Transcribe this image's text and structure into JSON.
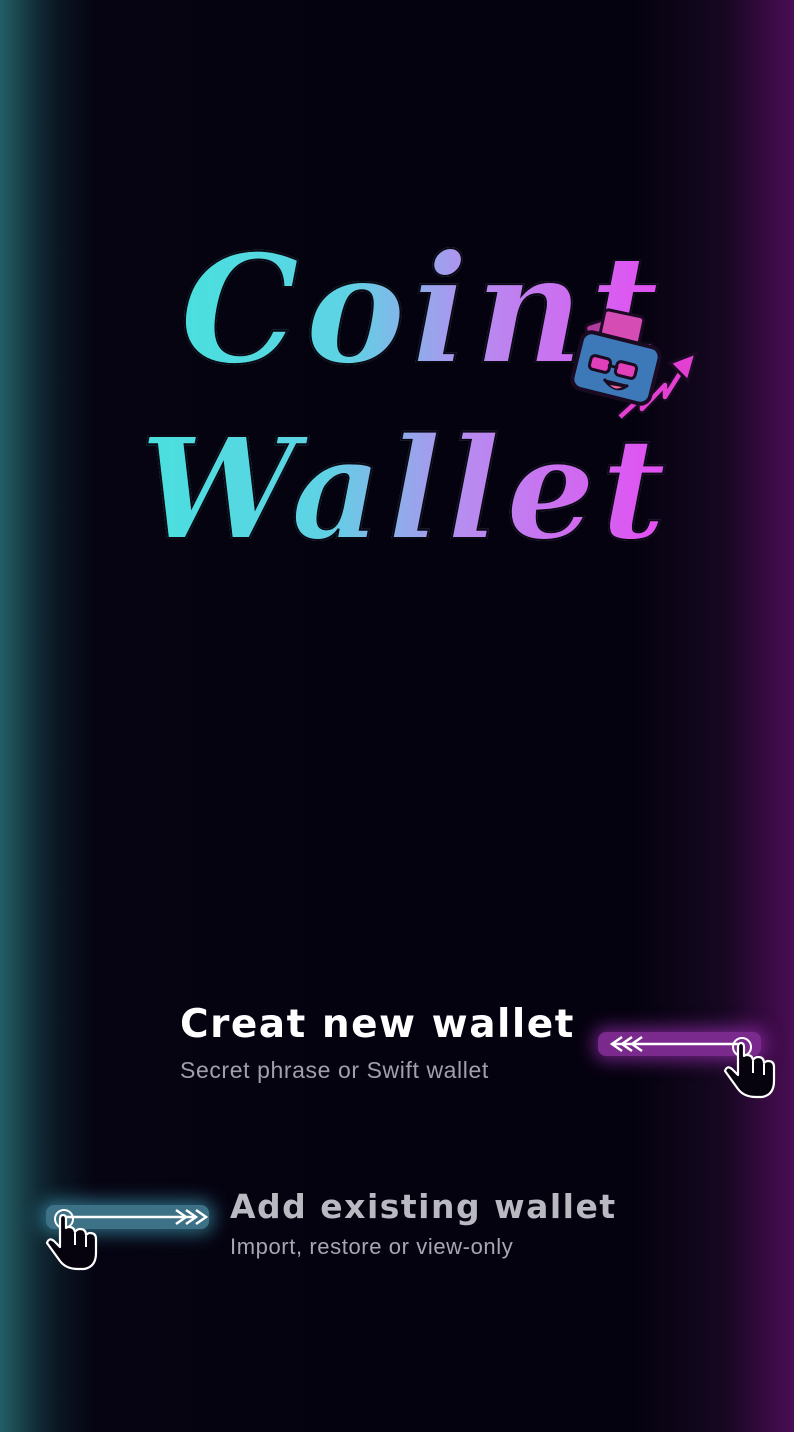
{
  "brand": {
    "line1": "Coint",
    "line2": "Wallet",
    "mascot_icon": "wallet-mascot-icon"
  },
  "actions": {
    "create": {
      "title": "Creat new wallet",
      "subtitle": "Secret phrase or Swift wallet",
      "slider_icon": "swipe-left-arrows-icon",
      "accent": "#c63fe0"
    },
    "add": {
      "title": "Add existing wallet",
      "subtitle": "Import, restore or view-only",
      "slider_icon": "swipe-right-arrows-icon",
      "accent": "#4fc6e6"
    }
  },
  "colors": {
    "background": "#05020f",
    "logo_gradient_start": "#49e0de",
    "logo_gradient_end": "#e54cf1"
  }
}
